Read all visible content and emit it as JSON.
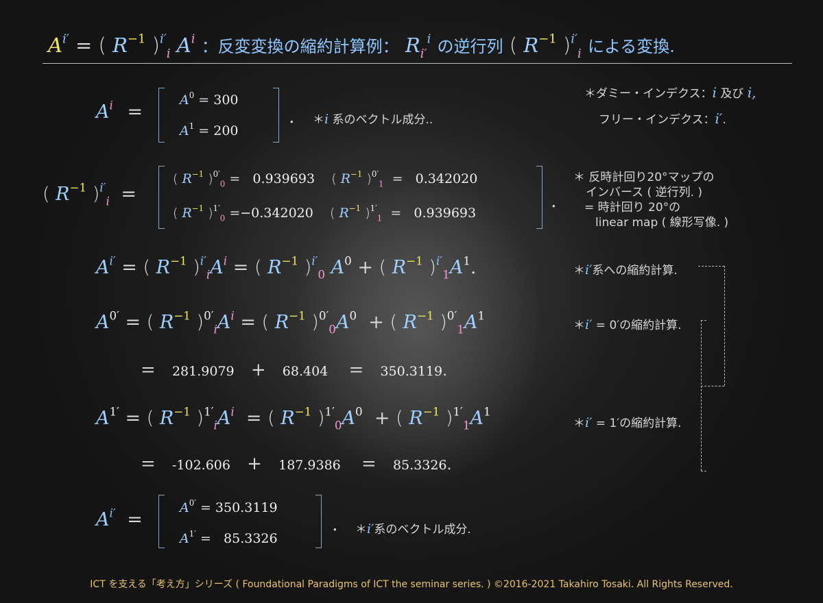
{
  "title": {
    "lhs": "A",
    "sup_lhs": "i′",
    "eq": "=",
    "rinv": "R",
    "minus1": "−1",
    "sup_prime": "i′",
    "sub_i": "i",
    "ai": "A",
    "ai_sup": "i",
    "desc1": "：反変変換の縮約計算例：",
    "r": "R",
    "r_sub": "i′",
    "r_sup": "i",
    "desc2": "の逆行列",
    "desc3": "による変換."
  },
  "vector_a": {
    "lhs": "A",
    "lhs_sup": "i",
    "eq": "=",
    "row0_label": "A",
    "row0_sup": "0",
    "row0_value": "300",
    "row1_label": "A",
    "row1_sup": "1",
    "row1_value": "200",
    "period": ".",
    "note_star": "＊",
    "note_i": "i",
    "note_text": "系のベクトル成分.."
  },
  "index_note": {
    "line1_prefix": "＊ダミー・インデクス：",
    "line1_i1": "i",
    "line1_mid": "及び",
    "line1_i2": "i,",
    "line2_prefix": "フリー・インデクス：",
    "line2_i": "i′",
    "line2_suffix": "."
  },
  "matrix": {
    "eq": "=",
    "r": "R",
    "m1": "−1",
    "sup0": "0′",
    "sup1": "1′",
    "sub0": "0",
    "sub1": "1",
    "v00": "0.939693",
    "v01": "0.342020",
    "v10": "−0.342020",
    "v11": "0.939693",
    "period": ".",
    "note_line1": "＊ 反時計回り20°マップの",
    "note_line2": "インバース ( 逆行列. )",
    "note_line3": "= 時計回り 20°の",
    "note_line4": "linear map ( 線形写像. )"
  },
  "general_eq": {
    "note": "系への縮約計算.",
    "period": "."
  },
  "a0_eq": {
    "note_prefix": "=",
    "note_val": "0′",
    "note_suffix": "の縮約計算.",
    "term1": "281.9079",
    "plus": "+",
    "term2": "68.404",
    "eq": "=",
    "result": "350.3119",
    "period": "."
  },
  "a1_eq": {
    "note_prefix": "=",
    "note_val": "1′",
    "note_suffix": "の縮約計算.",
    "term1": "-102.606",
    "plus": "+",
    "term2": "187.9386",
    "eq": "=",
    "result": "85.3326",
    "period": "."
  },
  "result_vector": {
    "row0_sup": "0′",
    "row0_value": "350.3119",
    "row1_sup": "1′",
    "row1_value": "85.3326",
    "period": ".",
    "note_text": "系のベクトル成分."
  },
  "footer": "ICT を支える「考え方」シリーズ ( Foundational Paradigms of ICT the seminar series. ) ©2016-2021 Takahiro Tosaki. All Rights Reserved."
}
